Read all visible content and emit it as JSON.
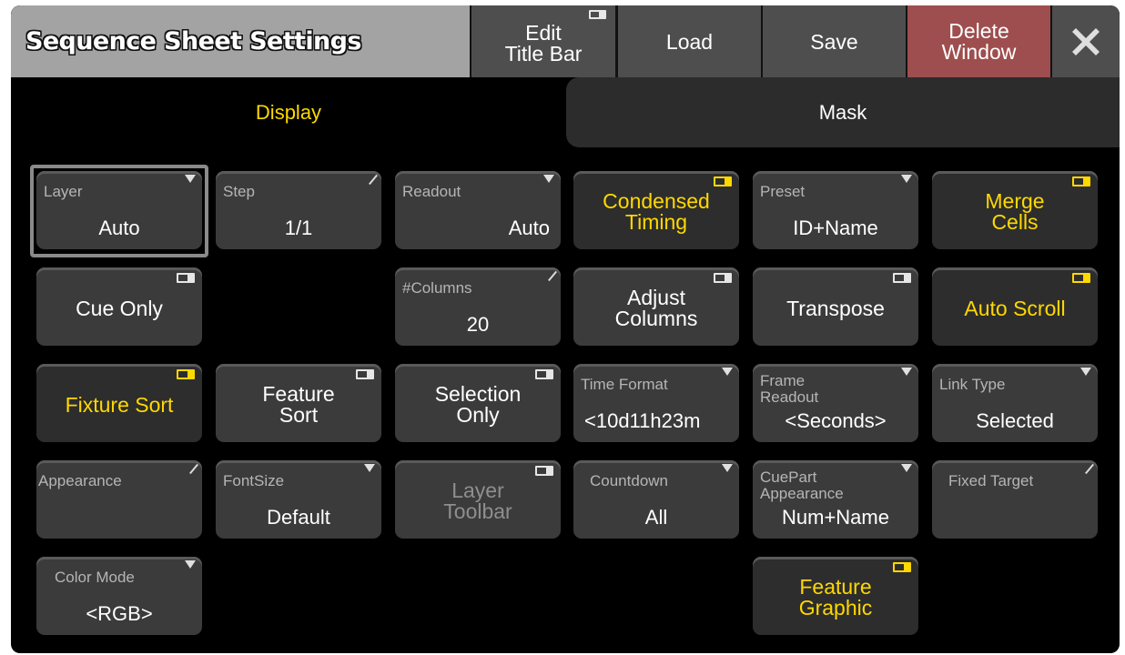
{
  "window": {
    "title": "Sequence Sheet Settings",
    "buttons": {
      "edit_title_bar": "Edit Title Bar",
      "edit_line1": "Edit",
      "edit_line2": "Title Bar",
      "load": "Load",
      "save": "Save",
      "delete_line1": "Delete",
      "delete_line2": "Window",
      "close_icon": "close-x-icon"
    }
  },
  "tabs": [
    {
      "label": "Display",
      "active": true
    },
    {
      "label": "Mask",
      "active": false
    }
  ],
  "colors": {
    "accent_yellow": "#ffd800",
    "button_gray": "#3b3b3b",
    "delete_red": "#9e4e4e",
    "title_gray": "#a3a3a3"
  },
  "settings": {
    "layer": {
      "label": "Layer",
      "value": "Auto"
    },
    "step": {
      "label": "Step",
      "value": "1/1"
    },
    "readout": {
      "label": "Readout",
      "value": "Auto"
    },
    "condensed_timing": {
      "line1": "Condensed",
      "line2": "Timing",
      "on": true
    },
    "preset": {
      "label": "Preset",
      "value": "ID+Name"
    },
    "merge_cells": {
      "line1": "Merge",
      "line2": "Cells",
      "on": true
    },
    "cue_only": {
      "label": "Cue Only",
      "on": false
    },
    "columns": {
      "label": "#Columns",
      "value": "20"
    },
    "adjust_columns": {
      "line1": "Adjust",
      "line2": "Columns",
      "on": false
    },
    "transpose": {
      "label": "Transpose",
      "on": false
    },
    "auto_scroll": {
      "label": "Auto Scroll",
      "on": true
    },
    "fixture_sort": {
      "label": "Fixture Sort",
      "on": true
    },
    "feature_sort": {
      "line1": "Feature",
      "line2": "Sort",
      "on": false
    },
    "selection_only": {
      "line1": "Selection",
      "line2": "Only",
      "on": false
    },
    "time_format": {
      "label": "Time Format",
      "value": "<10d11h23m"
    },
    "frame_readout": {
      "label1": "Frame",
      "label2": "Readout",
      "value": "<Seconds>"
    },
    "link_type": {
      "label": "Link Type",
      "value": "Selected"
    },
    "appearance": {
      "label": "Appearance"
    },
    "font_size": {
      "label": "FontSize",
      "value": "Default"
    },
    "layer_toolbar": {
      "line1": "Layer",
      "line2": "Toolbar",
      "on": false
    },
    "countdown": {
      "label": "Countdown",
      "value": "All"
    },
    "cuepart_appearance": {
      "label1": "CuePart",
      "label2": "Appearance",
      "value": "Num+Name"
    },
    "fixed_target": {
      "label": "Fixed Target"
    },
    "color_mode": {
      "label": "Color Mode",
      "value": "<RGB>"
    },
    "feature_graphic": {
      "line1": "Feature",
      "line2": "Graphic",
      "on": true
    }
  }
}
